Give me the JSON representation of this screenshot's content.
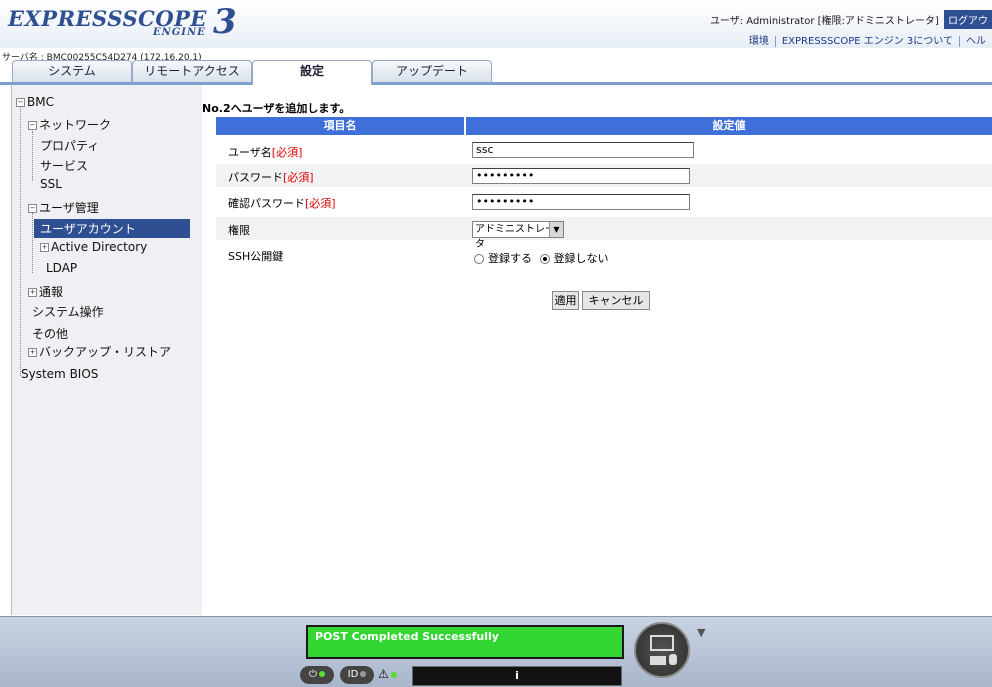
{
  "header": {
    "logo_main": "EXPRESSSCOPE",
    "logo_sub": "ENGINE",
    "logo_num": "3",
    "user_info": "ユーザ: Administrator [権限:アドミニストレータ]",
    "logout": "ログアウ",
    "links": [
      "環境",
      "EXPRESSSCOPE エンジン 3について",
      "ヘル"
    ],
    "server_name": "サーバ名 : BMC00255C54D274 (172.16.20.1)"
  },
  "tabs": [
    "システム",
    "リモートアクセス",
    "設定",
    "アップデート"
  ],
  "sidebar": {
    "bmc": "BMC",
    "network": "ネットワーク",
    "property": "プロパティ",
    "service": "サービス",
    "ssl": "SSL",
    "user_mgmt": "ユーザ管理",
    "user_account": "ユーザアカウント",
    "active_directory": "Active Directory",
    "ldap": "LDAP",
    "notify": "通報",
    "system_ops": "システム操作",
    "others": "その他",
    "backup": "バックアップ・リストア",
    "bios": "System BIOS"
  },
  "form": {
    "title": "No.2へユーザを追加します。",
    "col_item": "項目名",
    "col_value": "設定値",
    "required": "[必須]",
    "username_label": "ユーザ名",
    "username_value": "ssc",
    "password_label": "パスワード",
    "password_value": "•••••••••",
    "confirm_label": "確認パスワード",
    "confirm_value": "•••••••••",
    "privilege_label": "権限",
    "privilege_value": "アドミニストレータ",
    "ssh_label": "SSH公開鍵",
    "ssh_register": "登録する",
    "ssh_no_register": "登録しない",
    "apply": "適用",
    "cancel": "キャンセル"
  },
  "footer": {
    "lcd": "POST Completed Successfully",
    "info": "i"
  }
}
